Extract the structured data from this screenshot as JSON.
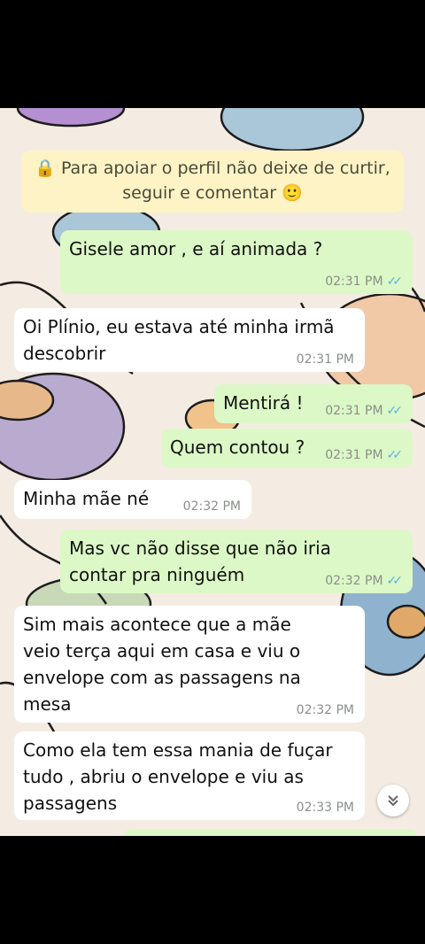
{
  "notice": {
    "icon": "lock-icon",
    "text": "🔒 Para apoiar o perfil não deixe de curtir, seguir e comentar 🙂"
  },
  "messages": [
    {
      "dir": "out",
      "text": "Gisele amor , e aí animada ?",
      "time": "02:31 PM",
      "read": true
    },
    {
      "dir": "in",
      "text": "Oi Plínio, eu estava até minha irmã descobrir",
      "time": "02:31 PM"
    },
    {
      "dir": "out",
      "text": "Mentirá !",
      "time": "02:31 PM",
      "read": true
    },
    {
      "dir": "out",
      "text": "Quem contou ?",
      "time": "02:31 PM",
      "read": true
    },
    {
      "dir": "in",
      "text": "Minha mãe né",
      "time": "02:32 PM"
    },
    {
      "dir": "out",
      "text": "Mas vc não disse que não iria contar pra ninguém",
      "time": "02:32 PM",
      "read": true
    },
    {
      "dir": "in",
      "text": "Sim mais acontece que a mãe veio terça aqui em casa e viu o envelope com as passagens na mesa",
      "time": "02:32 PM"
    },
    {
      "dir": "in",
      "text": "Como ela tem essa mania de fuçar tudo , abriu o envelope e viu as passagens",
      "time": "02:33 PM"
    }
  ],
  "scroll_button": {
    "icon": "chevron-double-down-icon"
  },
  "colors": {
    "outgoing": "#dcf8c6",
    "incoming": "#ffffff",
    "notice": "#fdf3c4",
    "read_ticks": "#4fb6ec"
  }
}
